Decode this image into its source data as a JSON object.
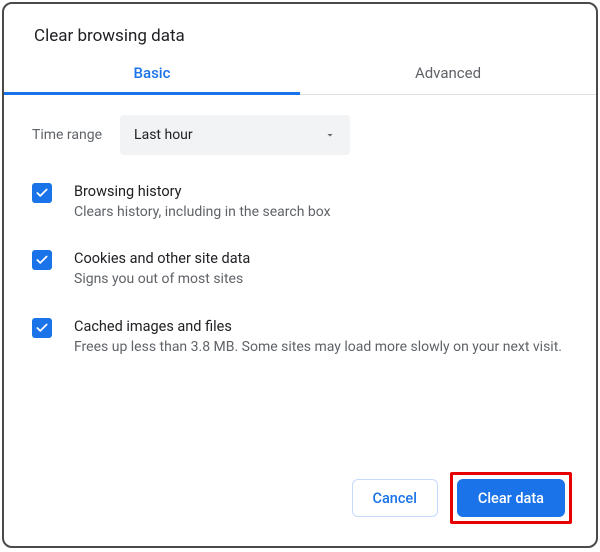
{
  "dialog": {
    "title": "Clear browsing data"
  },
  "tabs": {
    "basic": "Basic",
    "advanced": "Advanced",
    "active": "basic"
  },
  "timerange": {
    "label": "Time range",
    "selected": "Last hour"
  },
  "options": [
    {
      "checked": true,
      "title": "Browsing history",
      "desc": "Clears history, including in the search box"
    },
    {
      "checked": true,
      "title": "Cookies and other site data",
      "desc": "Signs you out of most sites"
    },
    {
      "checked": true,
      "title": "Cached images and files",
      "desc": "Frees up less than 3.8 MB. Some sites may load more slowly on your next visit."
    }
  ],
  "buttons": {
    "cancel": "Cancel",
    "clear": "Clear data"
  },
  "colors": {
    "accent": "#1a73e8",
    "highlight": "#e60000"
  }
}
